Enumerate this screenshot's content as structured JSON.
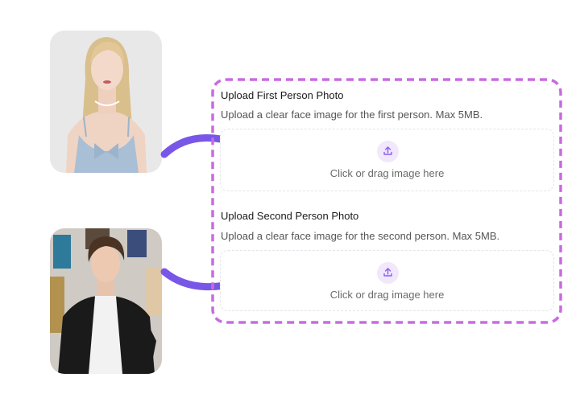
{
  "colors": {
    "accent": "#8b5cf6",
    "panel_border": "#c86be0",
    "arrow": "#7857e8",
    "upload_icon_bg": "#f1e8fb"
  },
  "uploads": [
    {
      "title": "Upload First Person Photo",
      "description": "Upload a clear face image for the first person. Max 5MB.",
      "dropzone_text": "Click or drag image here",
      "icon": "upload-icon"
    },
    {
      "title": "Upload Second Person Photo",
      "description": "Upload a clear face image for the second person. Max 5MB.",
      "dropzone_text": "Click or drag image here",
      "icon": "upload-icon"
    }
  ]
}
